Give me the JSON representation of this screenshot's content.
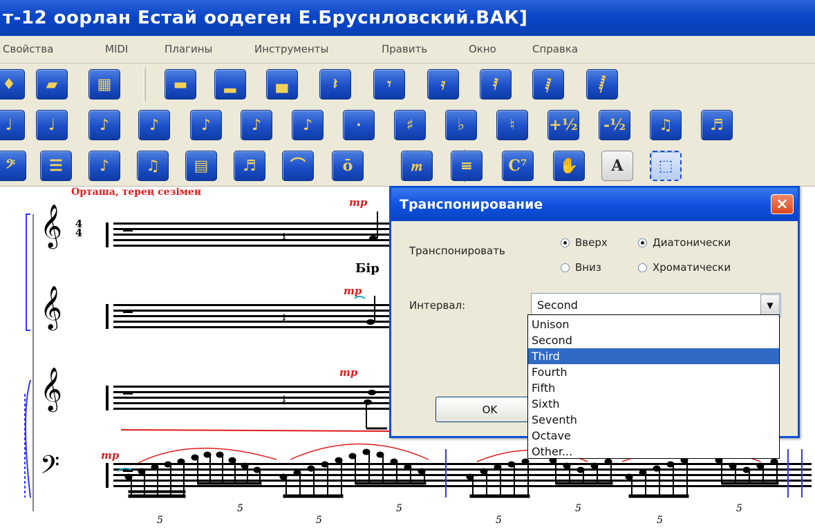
{
  "window": {
    "title": "т-12 оорлан Естай оодеген Е.Бруснловский.ВАК]"
  },
  "menu": [
    "Свойства",
    "MIDI",
    "Плагины",
    "Инструменты",
    "Править",
    "Окно",
    "Справка"
  ],
  "toolbar": {
    "row1": [
      {
        "name": "palette-icon",
        "glyph": "♦"
      },
      {
        "name": "open-score-icon",
        "glyph": "▰"
      },
      {
        "name": "keyboard-icon",
        "glyph": "▦"
      },
      {
        "name": "whole-rest-icon",
        "glyph": "▬"
      },
      {
        "name": "half-rest-icon",
        "glyph": "▂"
      },
      {
        "name": "half-rest-alt-icon",
        "glyph": "▄"
      },
      {
        "name": "quarter-rest-icon",
        "glyph": "𝄽"
      },
      {
        "name": "eighth-rest-icon",
        "glyph": "𝄾"
      },
      {
        "name": "sixteenth-rest-icon",
        "glyph": "𝄿"
      },
      {
        "name": "thirty-second-rest-icon",
        "glyph": "𝅀"
      },
      {
        "name": "sixty-fourth-rest-icon",
        "glyph": "𝅁"
      },
      {
        "name": "hundred-twenty-eighth-rest-icon",
        "glyph": "𝅂"
      }
    ],
    "row2": [
      {
        "name": "half-note-icon",
        "glyph": "♩"
      },
      {
        "name": "quarter-note-icon",
        "glyph": "♩"
      },
      {
        "name": "eighth-note-icon",
        "glyph": "♪"
      },
      {
        "name": "sixteenth-note-icon",
        "glyph": "♪"
      },
      {
        "name": "thirty-second-note-icon",
        "glyph": "♪"
      },
      {
        "name": "sixty-fourth-note-icon",
        "glyph": "♪"
      },
      {
        "name": "dotted-note-icon",
        "glyph": "♪"
      },
      {
        "name": "dot-icon",
        "glyph": "·"
      },
      {
        "name": "sharp-icon",
        "glyph": "♯"
      },
      {
        "name": "flat-icon",
        "glyph": "♭"
      },
      {
        "name": "natural-icon",
        "glyph": "♮"
      },
      {
        "name": "transpose-up-icon",
        "glyph": "+½"
      },
      {
        "name": "transpose-down-icon",
        "glyph": "-½"
      },
      {
        "name": "beam-icon",
        "glyph": "♫"
      },
      {
        "name": "tuplet-icon",
        "glyph": "♬"
      }
    ],
    "row3": [
      {
        "name": "bass-clef-icon",
        "glyph": "𝄢"
      },
      {
        "name": "staff-icon",
        "glyph": "☰"
      },
      {
        "name": "note-entry-icon",
        "glyph": "♪"
      },
      {
        "name": "playback-icon",
        "glyph": "♫"
      },
      {
        "name": "piano-icon",
        "glyph": "▤"
      },
      {
        "name": "chord-icon",
        "glyph": "♬"
      },
      {
        "name": "slur-icon",
        "glyph": "⌒"
      },
      {
        "name": "tremolo-icon",
        "glyph": "ō"
      },
      {
        "name": "dynamics-icon",
        "glyph": "𝆐"
      },
      {
        "name": "text-block-icon",
        "glyph": "≡"
      },
      {
        "name": "chord-symbol-icon",
        "glyph": "C⁷"
      },
      {
        "name": "hand-icon",
        "glyph": "✋"
      },
      {
        "name": "text-tool-icon",
        "glyph": "A"
      },
      {
        "name": "selection-tool-icon",
        "glyph": "⬚"
      }
    ]
  },
  "score": {
    "heading": "Орташа, терең сезімен",
    "dynamic": "mp",
    "bir_text": "Бір",
    "tuplet_number": "5"
  },
  "dialog": {
    "title": "Транспонирование",
    "close_label": "×",
    "transpose_label": "Транспонировать",
    "direction_up": "Вверх",
    "direction_down": "Вниз",
    "mode_diatonic": "Диатонически",
    "mode_chromatic": "Хроматически",
    "interval_label": "Интервал:",
    "interval_value": "Second",
    "ok_label": "OK"
  },
  "dropdown": {
    "options": [
      "Unison",
      "Second",
      "Third",
      "Fourth",
      "Fifth",
      "Sixth",
      "Seventh",
      "Octave",
      "Other..."
    ],
    "highlighted": "Third"
  },
  "colors": {
    "title_bar": "#0a46c8",
    "toolbar_button": "#1c4fc7",
    "annotation_red": "#e21b1b",
    "highlight": "#316ac5"
  }
}
